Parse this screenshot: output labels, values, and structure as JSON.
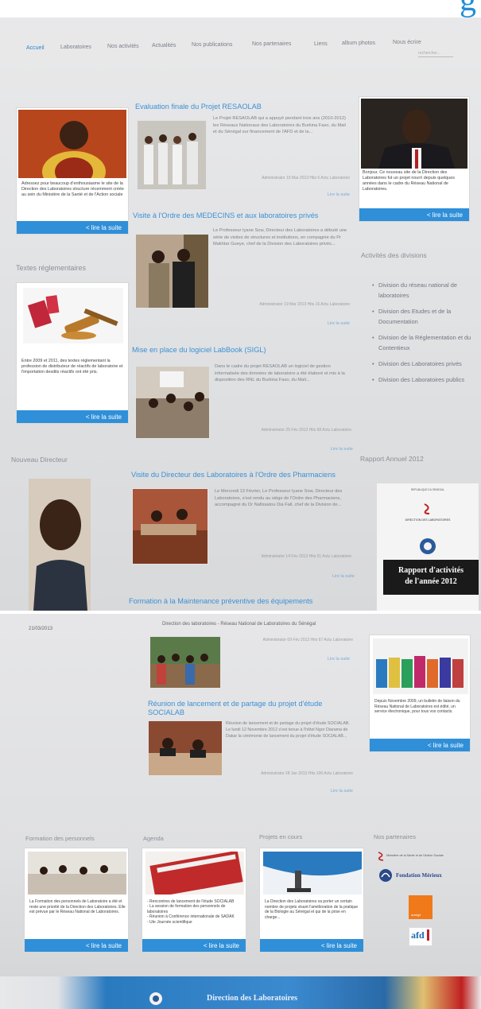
{
  "site": {
    "banner_fragment": "g"
  },
  "nav": {
    "items": [
      "Accueil",
      "Laboratoires",
      "Nos activités",
      "Actualités",
      "Nos publications",
      "Nos partenaires",
      "Liens",
      "album photos",
      "Nous écrire"
    ],
    "search_placeholder": "rechercher..."
  },
  "left": {
    "intro_text": "Adressez pour beaucoup d'enthousiasme le site de la Direction des Laboratoires structure récemment créée au sein du Ministère de la Santé et de l'Action sociale",
    "intro_read": "< lire la suite",
    "textes_heading": "Textes réglementaires",
    "textes_text": "Entre 2009 et 2011, des textes réglementant la profession de distributeur de réactifs de laboratoire et l'importation desdits réactifs ont été pris.",
    "textes_read": "< lire la suite",
    "director_heading": "Nouveau Directeur"
  },
  "articles": [
    {
      "title": "Evaluation finale du Projet RESAOLAB",
      "body": "Le Projet RESAOLAB qui a appuyé pendant trois ans (2010-2012) les Réseaux Nationaux des Laboratoires du Burkina Faso, du Mali et du Sénégal sur financement de l'AFD et de la...",
      "meta": "Administrator 19 Mar 2013 Hits 6 Actu Laboratoire",
      "read": "Lire la suite"
    },
    {
      "title": "Visite à l'Ordre des MEDECINS et aux laboratoires privés",
      "body": "Le Professeur Iyane Sow, Directeur des Laboratoires a débuté une série de visites de structures et institutions, en compagnie du Pr Makhtar Gueye, chef de la Division des Laboratoires privés...",
      "meta": "Administrator 19 Mar 2013 Hits 16 Actu Laboratoire",
      "read": "Lire la suite"
    },
    {
      "title": "Mise en place du logiciel LabBook (SIGL)",
      "body": "Dans le cadre du projet RESAOLAB un logiciel de gestion informatisée des données de laboratoire a été élaboré et mis à la disposition des RNL du Burkina Faso, du Mali...",
      "meta": "Administrator 25 Fév 2013 Hits 68 Actu Laboratoire",
      "read": "Lire la suite"
    },
    {
      "title": "Visite du Directeur des Laboratoires à l'Ordre des Pharmaciens",
      "body": "Le Mercredi 13 Février, Le Professeur Iyane Sow, Directeur des Laboratoires, s'est rendu au siège de l'Ordre des Pharmaciens, accompagné du Dr Nafissatou Dia Fall, chef de la Division de...",
      "meta": "Administrator 14 Fév 2013 Hits 51 Actu Laboratoire",
      "read": "Lire la suite"
    },
    {
      "title": "Formation à la Maintenance préventive des équipements",
      "body": "",
      "meta": "",
      "read": ""
    }
  ],
  "right": {
    "bonjour_text": "Bonjour, Ce nouveau site de la Direction des Laboratoires fut un projet nourri depuis quelques années dans le cadre du Réseau National de Laboratoires.",
    "bonjour_read": "< lire la suite",
    "divisions_heading": "Activités des divisions",
    "divisions": [
      "Division du réseau national de laboratoires",
      "Division des Etudes et de la Documentation",
      "Division de la Réglementation et du Contentieux",
      "Division des Laboratoires privés",
      "Division des Laboratoires publics"
    ],
    "rapport_heading": "Rapport Annuel 2012",
    "rapport_line1": "Rapport d'activités",
    "rapport_line2": "de l'année 2012",
    "rapport_small": "DIRECTION DES LABORATOIRES",
    "rapport_small2": "REPUBLIQUE DU SENEGAL"
  },
  "print": {
    "date": "21/03/2013",
    "header": "Direction des laboratoires - Réseau National de Laboratoires du Sénégal"
  },
  "p2": {
    "article_top_meta": "Administrator 09 Fév 2013 Hits 67 Actu Laboratoire",
    "article_top_read": "Lire la suite",
    "article2_title": "Réunion de lancement et de partage du projet d'étude SOCIALAB",
    "article2_body": "Réunion de lancement et de partage du projet d'étude SOCIALAB. Le lundi 12 Novembre 2012 s'est tenue à l'hôtel Ngor Diarama de Dakar la cérémonie de lancement du projet d'étude SOCIALAB...",
    "article2_meta": "Administrator 28 Jan 2013 Hits 106 Actu Laboratoire",
    "article2_read": "Lire la suite",
    "bulletin_text": "Depuis Novembre 2009, un bulletin de liaison du Réseau National de Laboratoires est édité, un service électronique, pour tous vos contacts.",
    "bulletin_read": "< lire la suite",
    "footer": [
      {
        "heading": "Formation des personnels",
        "text": "La Formation des personnels de Laboratoire a été et reste une priorité de la Direction des Laboratoires. Elle est prévue par le Réseau National de Laboratoires.",
        "read": "< lire la suite"
      },
      {
        "heading": "Agenda",
        "text": "- Rencontres de lancement de l'étude SOCIALAB\n- La session de formation des personnels de laboratoires\n- Réunion à Conférence internationale de SADAK\n- Ute Journée scientifique",
        "read": "< lire la suite"
      },
      {
        "heading": "Projets en cours",
        "text": "La Direction des Laboratoires va porter un certain nombre de projets visant l'amélioration de la pratique de la Biologie au Sénégal et qui de la prise en charge...",
        "read": "< lire la suite"
      }
    ],
    "partners_heading": "Nos partenaires",
    "partner_ministry": "Ministère de la Santé et de l'Action Sociale",
    "partner_fondation": "Fondation Mérieux",
    "partner_orange": "orange",
    "partner_afd": "afd",
    "bottom_banner": "Direction des Laboratoires"
  },
  "colors": {
    "accent": "#2f8fd8",
    "link": "#3b90d3",
    "page": "#e3e4e6"
  }
}
